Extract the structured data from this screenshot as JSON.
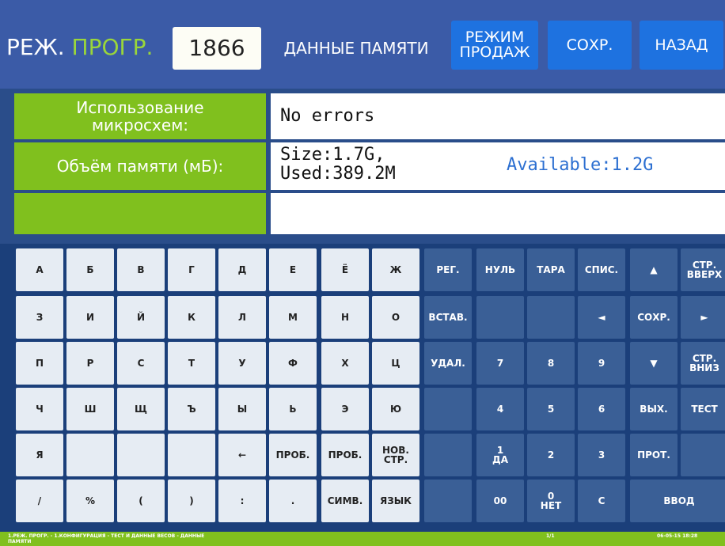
{
  "header": {
    "title_part1": "РЕЖ. ",
    "title_part2": "ПРОГР.",
    "program_number": "1866",
    "section_label": "ДАННЫЕ ПАМЯТИ",
    "sale_mode_label": "РЕЖИМ\nПРОДАЖ",
    "save_label": "СОХР.",
    "back_label": "НАЗАД"
  },
  "info": {
    "chip_label": "Использование\nмикросхем:",
    "chip_value": "No errors",
    "memory_label": "Объём памяти (мБ):",
    "memory_size_used": "Size:1.7G,\nUsed:389.2M",
    "memory_available": "Available:1.2G",
    "empty_label": "",
    "empty_value": ""
  },
  "keyboard": {
    "rows": [
      [
        "А",
        "Б",
        "В",
        "Г",
        "Д",
        "Е",
        "Ё",
        "Ж",
        "РЕГ.",
        "НУЛЬ",
        "ТАРА",
        "СПИС.",
        "▲",
        "СТР.\nВВЕРХ"
      ],
      [
        "З",
        "И",
        "Й",
        "К",
        "Л",
        "М",
        "Н",
        "О",
        "ВСТАВ.",
        "",
        "",
        "◄",
        "СОХР.",
        "►"
      ],
      [
        "П",
        "Р",
        "С",
        "Т",
        "У",
        "Ф",
        "Х",
        "Ц",
        "УДАЛ.",
        "7",
        "8",
        "9",
        "▼",
        "СТР.\nВНИЗ"
      ],
      [
        "Ч",
        "Ш",
        "Щ",
        "Ъ",
        "Ы",
        "Ь",
        "Э",
        "Ю",
        "",
        "4",
        "5",
        "6",
        "ВЫХ.",
        "ТЕСТ"
      ],
      [
        "Я",
        "",
        "",
        "",
        "←",
        "ПРОБ.",
        "ПРОБ.",
        "НОВ.\nСТР.",
        "",
        "1\nДА",
        "2",
        "3",
        "ПРОТ.",
        ""
      ],
      [
        "/",
        "%",
        "(",
        ")",
        ":",
        ".",
        "СИМВ.",
        "ЯЗЫК",
        "",
        "00",
        "0\nНЕТ",
        "С",
        "ВВОД"
      ]
    ]
  },
  "status": {
    "path": "1.РЕЖ. ПРОГР. - 1.КОНФИГУРАЦИЯ - ТЕСТ И ДАННЫЕ ВЕСОВ - ДАННЫЕ\nПАМЯТИ",
    "page": "1/1",
    "datetime": "06-05-15  18:28"
  },
  "colors": {
    "header_bg": "#3b5ba7",
    "accent_green": "#80c01e",
    "button_blue": "#1e72e0",
    "keyboard_bg": "#1b3f7a"
  }
}
